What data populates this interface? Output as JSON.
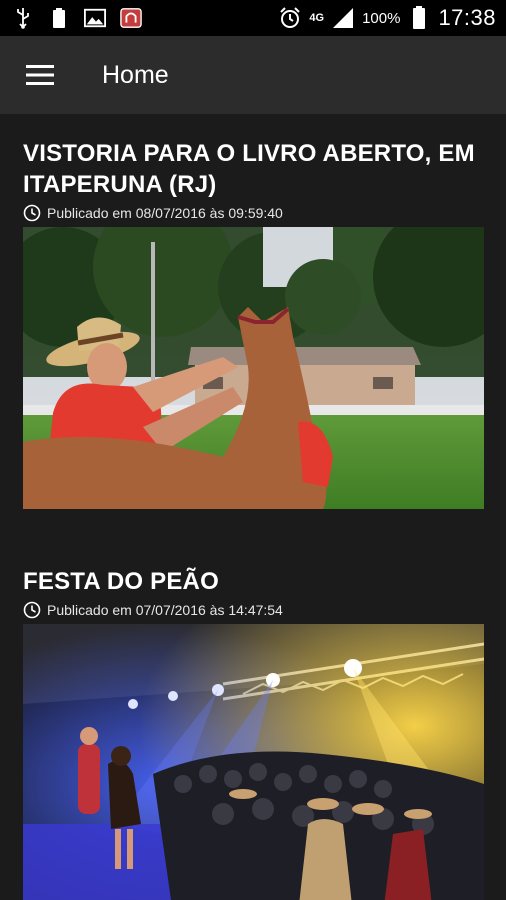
{
  "status_bar": {
    "network": "4G",
    "battery": "100%",
    "time": "17:38",
    "icons": [
      "usb-icon",
      "battery-small-icon",
      "image-icon",
      "app-notification-icon",
      "alarm-icon",
      "signal-icon",
      "battery-icon"
    ]
  },
  "app_bar": {
    "title": "Home",
    "menu_icon": "hamburger-menu-icon"
  },
  "posts": [
    {
      "title": "VISTORIA PARA O LIVRO ABERTO, EM ITAPERUNA (RJ)",
      "published": "Publicado em 08/07/2016 às 09:59:40",
      "image": "photo of a man in a straw hat and red shirt measuring a horse on a green field"
    },
    {
      "title": "FESTA DO PEÃO",
      "published": "Publicado em 07/07/2016 às 14:47:54",
      "image": "photo of a concert stage with blue and yellow lights and a crowd"
    }
  ],
  "colors": {
    "background": "#1b1b1b",
    "app_bar": "#2c2c2c",
    "status_bar": "#000000",
    "text": "#ffffff"
  }
}
